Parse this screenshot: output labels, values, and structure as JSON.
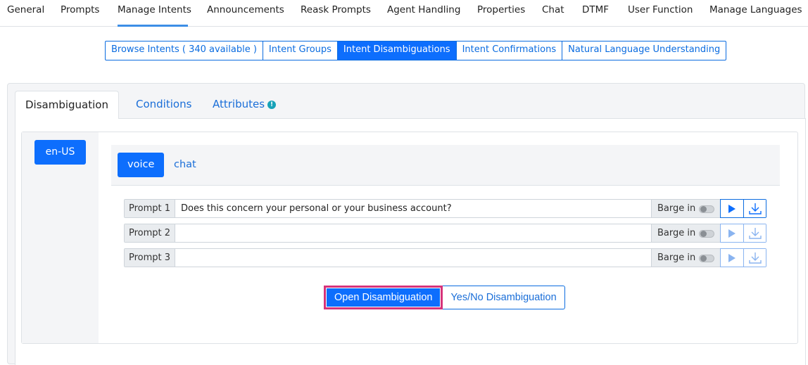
{
  "top_nav": {
    "items": [
      "General",
      "Prompts",
      "Manage Intents",
      "Announcements",
      "Reask Prompts",
      "Agent Handling",
      "Properties",
      "Chat",
      "DTMF",
      "User Function",
      "Manage Languages"
    ],
    "active": "Manage Intents"
  },
  "sub_tabs": {
    "items": [
      "Browse Intents ( 340 available )",
      "Intent Groups",
      "Intent Disambiguations",
      "Intent Confirmations",
      "Natural Language Understanding"
    ],
    "active": "Intent Disambiguations"
  },
  "panel_tabs": {
    "items": [
      "Disambiguation",
      "Conditions",
      "Attributes"
    ],
    "active": "Disambiguation",
    "attributes_icon": "info-icon"
  },
  "language": "en-US",
  "channels": {
    "voice": "voice",
    "chat": "chat",
    "active": "voice"
  },
  "prompts": [
    {
      "label": "Prompt 1",
      "value": "Does this concern your personal or your business account?",
      "barge_label": "Barge in",
      "barge_on": false,
      "play_enabled": true
    },
    {
      "label": "Prompt 2",
      "value": "",
      "barge_label": "Barge in",
      "barge_on": false,
      "play_enabled": false
    },
    {
      "label": "Prompt 3",
      "value": "",
      "barge_label": "Barge in",
      "barge_on": false,
      "play_enabled": false
    }
  ],
  "actions": {
    "open": "Open Disambiguation",
    "yesno": "Yes/No Disambiguation"
  },
  "colors": {
    "primary": "#0d6efd",
    "link": "#1a6ed8",
    "highlight_border": "#d6337a",
    "active_nav_underline": "#3d8ee6"
  }
}
